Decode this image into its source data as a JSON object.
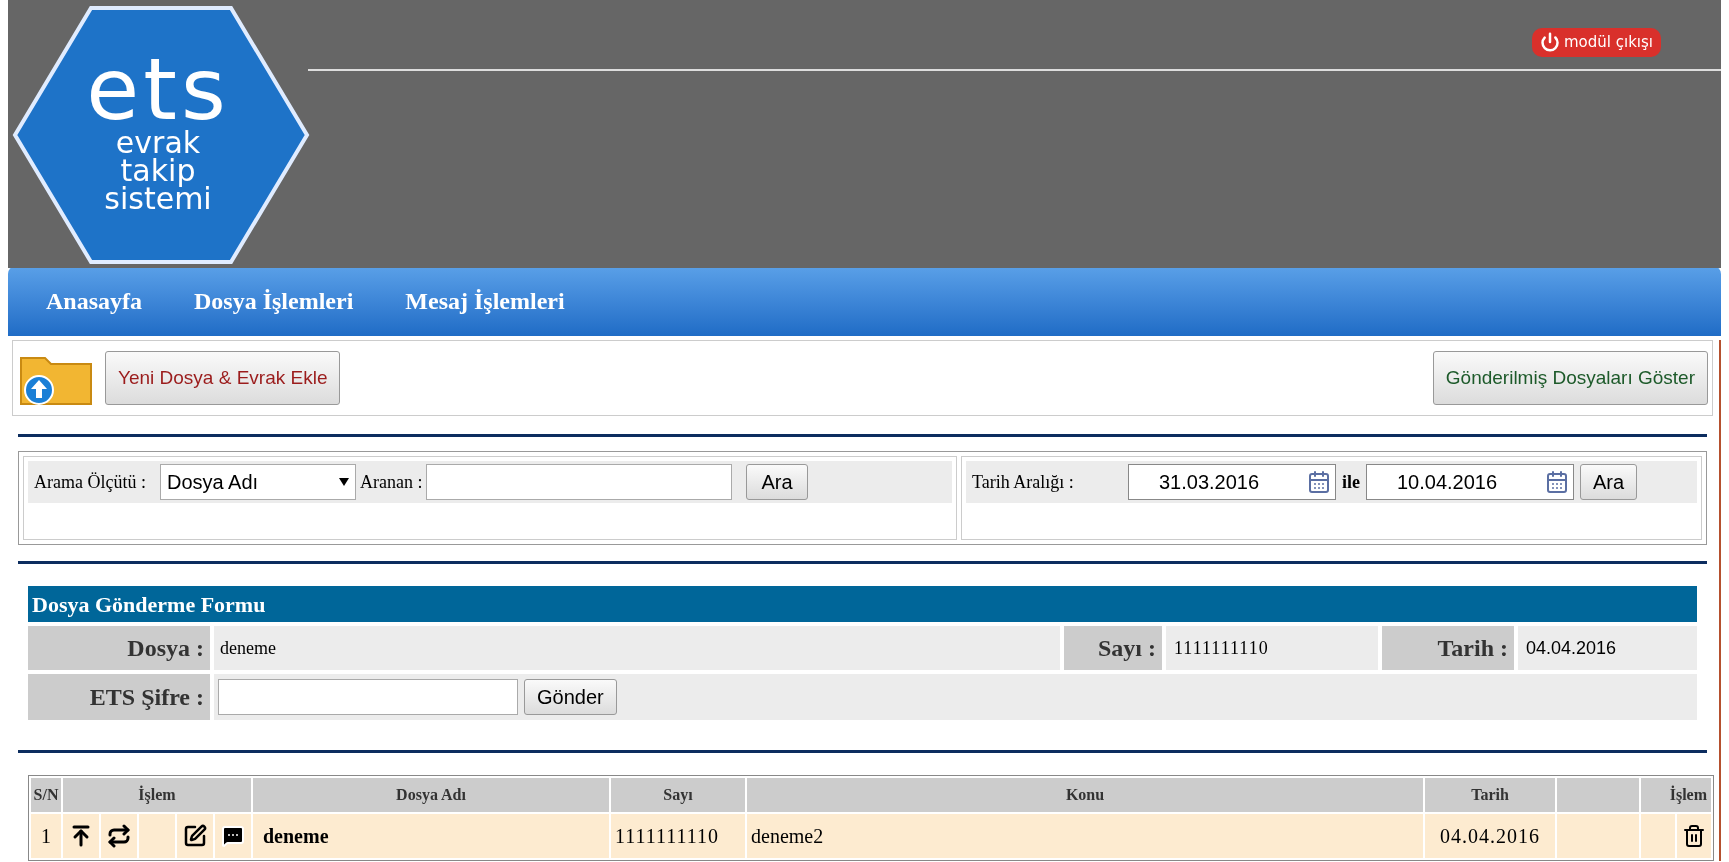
{
  "header": {
    "logo_lines": [
      "ets",
      "evrak",
      "takip",
      "sistemi"
    ],
    "exit_button": "modül çıkışı"
  },
  "nav": {
    "items": [
      "Anasayfa",
      "Dosya İşlemleri",
      "Mesaj İşlemleri"
    ]
  },
  "toolbar": {
    "new_button": "Yeni Dosya & Evrak Ekle",
    "sent_button": "Gönderilmiş Dosyaları Göster"
  },
  "search": {
    "criterion_label": "Arama Ölçütü :",
    "criterion_value": "Dosya Adı",
    "query_label": "Aranan :",
    "search_button": "Ara",
    "date_label": "Tarih Aralığı :",
    "date_from": "31.03.2016",
    "between": "ile",
    "date_to": "10.04.2016",
    "date_button": "Ara"
  },
  "form": {
    "title": "Dosya Gönderme Formu",
    "file_label": "Dosya :",
    "file_value": "deneme",
    "number_label": "Sayı :",
    "number_value": "1111111110",
    "date_label": "Tarih :",
    "date_value": "04.04.2016",
    "password_label": "ETS Şifre :",
    "send_button": "Gönder"
  },
  "table": {
    "columns": [
      "S/N",
      "İşlem",
      "Dosya Adı",
      "Sayı",
      "Konu",
      "Tarih",
      "İşlem"
    ],
    "rows": [
      {
        "sn": "1",
        "actions": [
          {
            "kind": "upload"
          },
          {
            "kind": "repeat"
          },
          {
            "kind": "blank"
          },
          {
            "kind": "edit"
          },
          {
            "kind": "comment"
          }
        ],
        "name": "deneme",
        "number": "1111111110",
        "subject": "deneme2",
        "date": "04.04.2016",
        "end_actions": [
          {
            "kind": "blank"
          },
          {
            "kind": "delete"
          }
        ]
      }
    ]
  }
}
